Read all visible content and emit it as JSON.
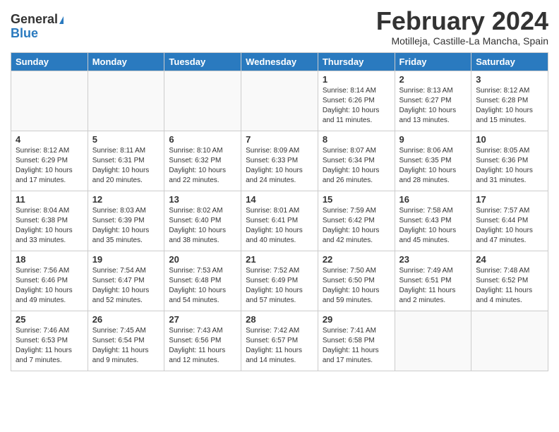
{
  "header": {
    "logo_general": "General",
    "logo_blue": "Blue",
    "month_title": "February 2024",
    "location": "Motilleja, Castille-La Mancha, Spain"
  },
  "days_of_week": [
    "Sunday",
    "Monday",
    "Tuesday",
    "Wednesday",
    "Thursday",
    "Friday",
    "Saturday"
  ],
  "weeks": [
    [
      {
        "day": "",
        "sunrise": "",
        "sunset": "",
        "daylight": ""
      },
      {
        "day": "",
        "sunrise": "",
        "sunset": "",
        "daylight": ""
      },
      {
        "day": "",
        "sunrise": "",
        "sunset": "",
        "daylight": ""
      },
      {
        "day": "",
        "sunrise": "",
        "sunset": "",
        "daylight": ""
      },
      {
        "day": "1",
        "sunrise": "Sunrise: 8:14 AM",
        "sunset": "Sunset: 6:26 PM",
        "daylight": "Daylight: 10 hours and 11 minutes."
      },
      {
        "day": "2",
        "sunrise": "Sunrise: 8:13 AM",
        "sunset": "Sunset: 6:27 PM",
        "daylight": "Daylight: 10 hours and 13 minutes."
      },
      {
        "day": "3",
        "sunrise": "Sunrise: 8:12 AM",
        "sunset": "Sunset: 6:28 PM",
        "daylight": "Daylight: 10 hours and 15 minutes."
      }
    ],
    [
      {
        "day": "4",
        "sunrise": "Sunrise: 8:12 AM",
        "sunset": "Sunset: 6:29 PM",
        "daylight": "Daylight: 10 hours and 17 minutes."
      },
      {
        "day": "5",
        "sunrise": "Sunrise: 8:11 AM",
        "sunset": "Sunset: 6:31 PM",
        "daylight": "Daylight: 10 hours and 20 minutes."
      },
      {
        "day": "6",
        "sunrise": "Sunrise: 8:10 AM",
        "sunset": "Sunset: 6:32 PM",
        "daylight": "Daylight: 10 hours and 22 minutes."
      },
      {
        "day": "7",
        "sunrise": "Sunrise: 8:09 AM",
        "sunset": "Sunset: 6:33 PM",
        "daylight": "Daylight: 10 hours and 24 minutes."
      },
      {
        "day": "8",
        "sunrise": "Sunrise: 8:07 AM",
        "sunset": "Sunset: 6:34 PM",
        "daylight": "Daylight: 10 hours and 26 minutes."
      },
      {
        "day": "9",
        "sunrise": "Sunrise: 8:06 AM",
        "sunset": "Sunset: 6:35 PM",
        "daylight": "Daylight: 10 hours and 28 minutes."
      },
      {
        "day": "10",
        "sunrise": "Sunrise: 8:05 AM",
        "sunset": "Sunset: 6:36 PM",
        "daylight": "Daylight: 10 hours and 31 minutes."
      }
    ],
    [
      {
        "day": "11",
        "sunrise": "Sunrise: 8:04 AM",
        "sunset": "Sunset: 6:38 PM",
        "daylight": "Daylight: 10 hours and 33 minutes."
      },
      {
        "day": "12",
        "sunrise": "Sunrise: 8:03 AM",
        "sunset": "Sunset: 6:39 PM",
        "daylight": "Daylight: 10 hours and 35 minutes."
      },
      {
        "day": "13",
        "sunrise": "Sunrise: 8:02 AM",
        "sunset": "Sunset: 6:40 PM",
        "daylight": "Daylight: 10 hours and 38 minutes."
      },
      {
        "day": "14",
        "sunrise": "Sunrise: 8:01 AM",
        "sunset": "Sunset: 6:41 PM",
        "daylight": "Daylight: 10 hours and 40 minutes."
      },
      {
        "day": "15",
        "sunrise": "Sunrise: 7:59 AM",
        "sunset": "Sunset: 6:42 PM",
        "daylight": "Daylight: 10 hours and 42 minutes."
      },
      {
        "day": "16",
        "sunrise": "Sunrise: 7:58 AM",
        "sunset": "Sunset: 6:43 PM",
        "daylight": "Daylight: 10 hours and 45 minutes."
      },
      {
        "day": "17",
        "sunrise": "Sunrise: 7:57 AM",
        "sunset": "Sunset: 6:44 PM",
        "daylight": "Daylight: 10 hours and 47 minutes."
      }
    ],
    [
      {
        "day": "18",
        "sunrise": "Sunrise: 7:56 AM",
        "sunset": "Sunset: 6:46 PM",
        "daylight": "Daylight: 10 hours and 49 minutes."
      },
      {
        "day": "19",
        "sunrise": "Sunrise: 7:54 AM",
        "sunset": "Sunset: 6:47 PM",
        "daylight": "Daylight: 10 hours and 52 minutes."
      },
      {
        "day": "20",
        "sunrise": "Sunrise: 7:53 AM",
        "sunset": "Sunset: 6:48 PM",
        "daylight": "Daylight: 10 hours and 54 minutes."
      },
      {
        "day": "21",
        "sunrise": "Sunrise: 7:52 AM",
        "sunset": "Sunset: 6:49 PM",
        "daylight": "Daylight: 10 hours and 57 minutes."
      },
      {
        "day": "22",
        "sunrise": "Sunrise: 7:50 AM",
        "sunset": "Sunset: 6:50 PM",
        "daylight": "Daylight: 10 hours and 59 minutes."
      },
      {
        "day": "23",
        "sunrise": "Sunrise: 7:49 AM",
        "sunset": "Sunset: 6:51 PM",
        "daylight": "Daylight: 11 hours and 2 minutes."
      },
      {
        "day": "24",
        "sunrise": "Sunrise: 7:48 AM",
        "sunset": "Sunset: 6:52 PM",
        "daylight": "Daylight: 11 hours and 4 minutes."
      }
    ],
    [
      {
        "day": "25",
        "sunrise": "Sunrise: 7:46 AM",
        "sunset": "Sunset: 6:53 PM",
        "daylight": "Daylight: 11 hours and 7 minutes."
      },
      {
        "day": "26",
        "sunrise": "Sunrise: 7:45 AM",
        "sunset": "Sunset: 6:54 PM",
        "daylight": "Daylight: 11 hours and 9 minutes."
      },
      {
        "day": "27",
        "sunrise": "Sunrise: 7:43 AM",
        "sunset": "Sunset: 6:56 PM",
        "daylight": "Daylight: 11 hours and 12 minutes."
      },
      {
        "day": "28",
        "sunrise": "Sunrise: 7:42 AM",
        "sunset": "Sunset: 6:57 PM",
        "daylight": "Daylight: 11 hours and 14 minutes."
      },
      {
        "day": "29",
        "sunrise": "Sunrise: 7:41 AM",
        "sunset": "Sunset: 6:58 PM",
        "daylight": "Daylight: 11 hours and 17 minutes."
      },
      {
        "day": "",
        "sunrise": "",
        "sunset": "",
        "daylight": ""
      },
      {
        "day": "",
        "sunrise": "",
        "sunset": "",
        "daylight": ""
      }
    ]
  ]
}
